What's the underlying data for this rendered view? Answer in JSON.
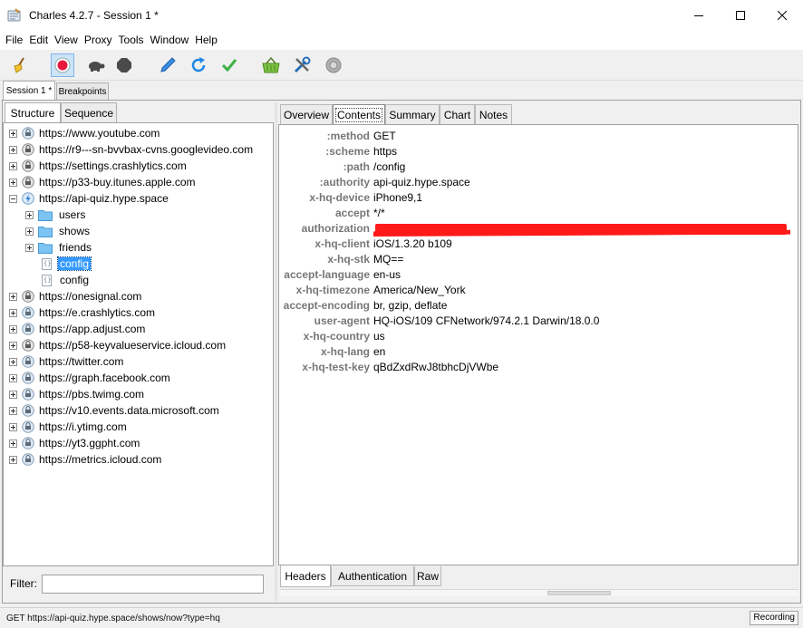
{
  "window": {
    "title": "Charles 4.2.7 - Session 1 *"
  },
  "menu": [
    "File",
    "Edit",
    "View",
    "Proxy",
    "Tools",
    "Window",
    "Help"
  ],
  "toolbar": {
    "icons": [
      "broom-icon",
      "record-icon",
      "turtle-icon",
      "stop-icon",
      "pen-icon",
      "refresh-icon",
      "checkmark-icon",
      "basket-icon",
      "tools-icon",
      "settings-icon"
    ],
    "recording_active": true
  },
  "session_tabs": [
    "Session 1 *",
    "Breakpoints"
  ],
  "left": {
    "tabs": [
      "Structure",
      "Sequence"
    ],
    "tree": [
      {
        "label": "https://www.youtube.com",
        "expanded": false
      },
      {
        "label": "https://r9---sn-bvvbax-cvns.googlevideo.com",
        "expanded": false
      },
      {
        "label": "https://settings.crashlytics.com",
        "expanded": false
      },
      {
        "label": "https://p33-buy.itunes.apple.com",
        "expanded": false
      },
      {
        "label": "https://api-quiz.hype.space",
        "expanded": true
      },
      {
        "label": "users",
        "kind": "folder"
      },
      {
        "label": "shows",
        "kind": "folder"
      },
      {
        "label": "friends",
        "kind": "folder"
      },
      {
        "label": "config",
        "kind": "file",
        "selected": true
      },
      {
        "label": "config",
        "kind": "file"
      },
      {
        "label": "https://onesignal.com",
        "expanded": false
      },
      {
        "label": "https://e.crashlytics.com",
        "expanded": false
      },
      {
        "label": "https://app.adjust.com",
        "expanded": false
      },
      {
        "label": "https://p58-keyvalueservice.icloud.com",
        "expanded": false
      },
      {
        "label": "https://twitter.com",
        "expanded": false
      },
      {
        "label": "https://graph.facebook.com",
        "expanded": false
      },
      {
        "label": "https://pbs.twimg.com",
        "expanded": false
      },
      {
        "label": "https://v10.events.data.microsoft.com",
        "expanded": false
      },
      {
        "label": "https://i.ytimg.com",
        "expanded": false
      },
      {
        "label": "https://yt3.ggpht.com",
        "expanded": false
      },
      {
        "label": "https://metrics.icloud.com",
        "expanded": false
      }
    ],
    "filter_label": "Filter:",
    "filter_value": ""
  },
  "right": {
    "tabs": [
      "Overview",
      "Contents",
      "Summary",
      "Chart",
      "Notes"
    ],
    "selected_tab": "Contents",
    "headers": [
      {
        "key": ":method",
        "value": "GET"
      },
      {
        "key": ":scheme",
        "value": "https"
      },
      {
        "key": ":path",
        "value": "/config"
      },
      {
        "key": ":authority",
        "value": "api-quiz.hype.space"
      },
      {
        "key": "x-hq-device",
        "value": "iPhone9,1"
      },
      {
        "key": "accept",
        "value": "*/*"
      },
      {
        "key": "authorization",
        "value": "",
        "redacted": true
      },
      {
        "key": "x-hq-client",
        "value": "iOS/1.3.20 b109"
      },
      {
        "key": "x-hq-stk",
        "value": "MQ=="
      },
      {
        "key": "accept-language",
        "value": "en-us"
      },
      {
        "key": "x-hq-timezone",
        "value": "America/New_York"
      },
      {
        "key": "accept-encoding",
        "value": "br, gzip, deflate"
      },
      {
        "key": "user-agent",
        "value": "HQ-iOS/109 CFNetwork/974.2.1 Darwin/18.0.0"
      },
      {
        "key": "x-hq-country",
        "value": "us"
      },
      {
        "key": "x-hq-lang",
        "value": "en"
      },
      {
        "key": "x-hq-test-key",
        "value": "qBdZxdRwJ8tbhcDjVWbe"
      }
    ],
    "bottom_tabs": [
      "Headers",
      "Authentication",
      "Raw"
    ]
  },
  "status": {
    "text": "GET https://api-quiz.hype.space/shows/now?type=hq",
    "recording": "Recording"
  },
  "colors": {
    "selection": "#3399ff",
    "redaction": "#ff1a1a",
    "header_key": "#777777"
  }
}
